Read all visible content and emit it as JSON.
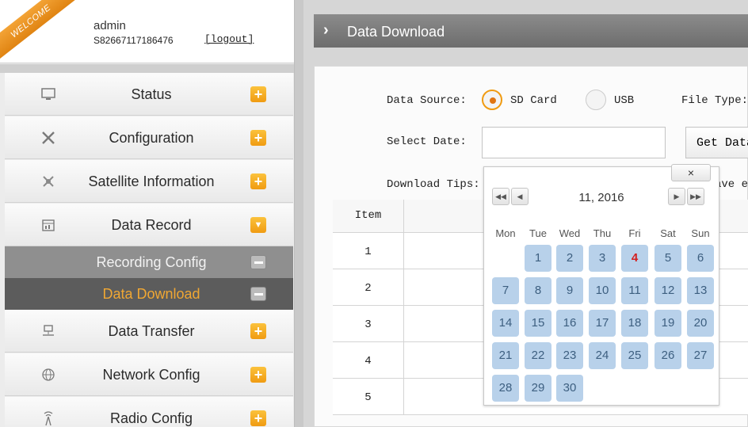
{
  "welcome": "WELCOME",
  "user": {
    "name": "admin",
    "device_id": "S82667117186476",
    "logout": "[logout]"
  },
  "sidebar": {
    "items": [
      {
        "label": "Status",
        "icon": "monitor-icon"
      },
      {
        "label": "Configuration",
        "icon": "tools-icon"
      },
      {
        "label": "Satellite Information",
        "icon": "satellite-icon"
      },
      {
        "label": "Data Record",
        "icon": "calendar-icon"
      },
      {
        "label": "Recording Config"
      },
      {
        "label": "Data Download"
      },
      {
        "label": "Data Transfer",
        "icon": "network-icon"
      },
      {
        "label": "Network Config",
        "icon": "globe-icon"
      },
      {
        "label": "Radio Config",
        "icon": "radio-tower-icon"
      }
    ]
  },
  "main": {
    "title": "Data Download",
    "data_source_label": "Data Source:",
    "source_options": [
      "SD Card",
      "USB"
    ],
    "file_type_label": "File Type:",
    "select_date_label": "Select Date:",
    "get_data_label": "Get Data",
    "download_tips_label": "Download Tips:",
    "tips_value_fragment": "ave e",
    "table": {
      "header": "Item",
      "rows": [
        "1",
        "2",
        "3",
        "4",
        "5"
      ]
    }
  },
  "calendar": {
    "close": "×",
    "month": "11, 2016",
    "weekdays": [
      "Mon",
      "Tue",
      "Wed",
      "Thu",
      "Fri",
      "Sat",
      "Sun"
    ],
    "days": [
      "1",
      "2",
      "3",
      "4",
      "5",
      "6",
      "7",
      "8",
      "9",
      "10",
      "11",
      "12",
      "13",
      "14",
      "15",
      "16",
      "17",
      "18",
      "19",
      "20",
      "21",
      "22",
      "23",
      "24",
      "25",
      "26",
      "27",
      "28",
      "29",
      "30"
    ],
    "first_weekday_index": 1,
    "today": "4"
  },
  "colors": {
    "accent": "#f09b12",
    "active_bg": "#5c5c5c",
    "active_text": "#f0a733",
    "sub_bg": "#8f8f8f",
    "day_bg": "#b8d1ea"
  }
}
